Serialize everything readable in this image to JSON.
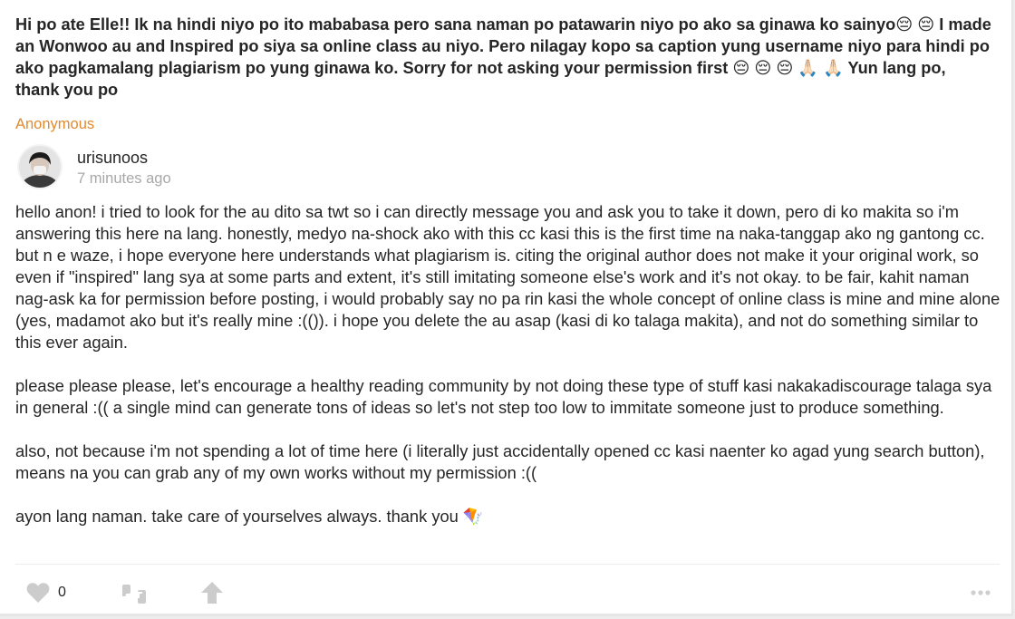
{
  "question": {
    "text": "Hi po ate Elle!! Ik na hindi niyo po ito mababasa pero sana naman po patawarin niyo po ako sa ginawa ko sainyo😔 😔 I made an Wonwoo au and Inspired po siya sa online class au niyo. Pero nilagay kopo sa caption yung username niyo para hindi po ako pagkamalang plagiarism po yung ginawa ko. Sorry for not asking your permission first 😔 😔 😔 🙏🏻 🙏🏻 Yun lang po, thank you po",
    "asker": "Anonymous"
  },
  "answerer": {
    "username": "urisunoos",
    "time": "7 minutes ago"
  },
  "answer": {
    "paragraphs": [
      "hello anon! i tried to look for the au dito sa twt so i can directly message you and ask you to take it down, pero di ko makita so i'm answering this here na lang. honestly, medyo na-shock ako with this cc kasi this is the first time na naka-tanggap ako ng gantong cc. but n e waze, i hope everyone here understands what plagiarism is. citing the original author does not make it your original work, so even if \"inspired\" lang sya at some parts and extent, it's still imitating someone else's work and it's not okay. to be fair, kahit naman nag-ask ka for permission before posting, i would probably say no pa rin kasi the whole concept of online class is mine and mine alone (yes, madamot ako but it's really mine :(()). i hope you delete the au asap (kasi di ko talaga makita), and not do something similar to this ever again.",
      "please please please, let's encourage a healthy reading community by not doing these type of stuff kasi nakakadiscourage talaga sya in general :(( a single mind can generate tons of ideas so let's not step too low to immitate someone just to produce something.",
      "also, not because i'm not spending a lot of time here (i literally just accidentally opened cc kasi naenter ko agad yung search button), means na you can grab any of my own works without my permission :((",
      "ayon lang naman. take care of yourselves always. thank you 🪁"
    ]
  },
  "actions": {
    "like_count": "0",
    "icons": [
      "heart-icon",
      "quote-icon",
      "share-arrow-icon",
      "more-dots-icon"
    ]
  },
  "colors": {
    "asker": "#e08a2e",
    "timestamp": "#a8a8a8",
    "icon": "#cccccc",
    "text": "#262626"
  }
}
